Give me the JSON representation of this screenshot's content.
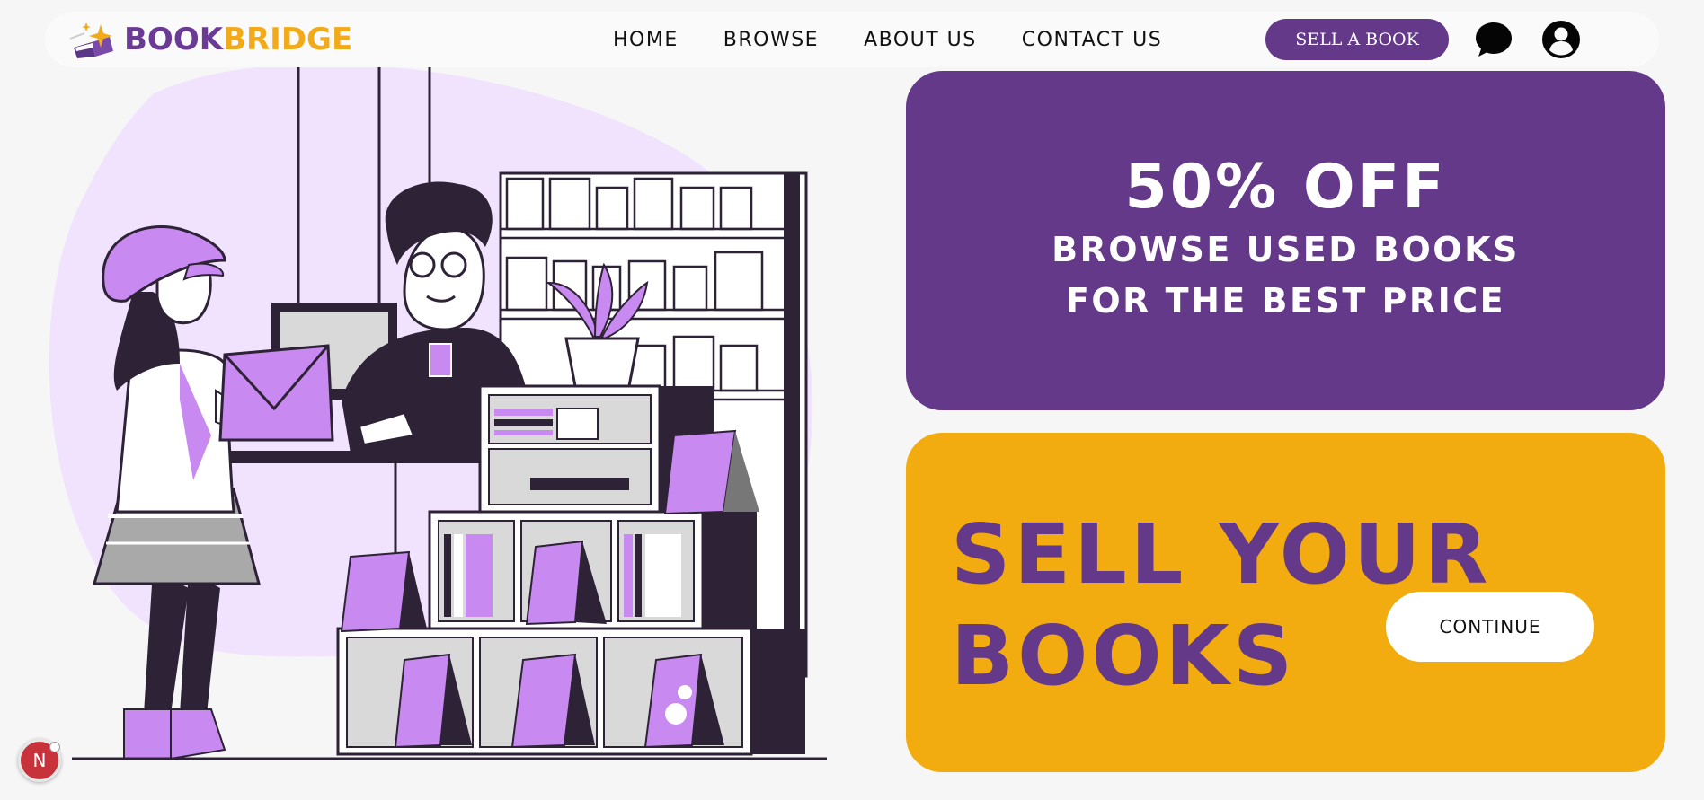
{
  "brand": {
    "name_part1": "BOOK",
    "name_part2": "BRIDGE",
    "logo_icon": "book-star-logo-icon",
    "colors": {
      "primary": "#653989",
      "accent": "#f2ac10",
      "background": "#f6f6f6"
    }
  },
  "nav": {
    "links": [
      "HOME",
      "BROWSE",
      "ABOUT US",
      "CONTACT US"
    ],
    "sell_button": "SELL A BOOK",
    "chat_icon": "chat-bubble-icon",
    "user_icon": "user-account-icon"
  },
  "hero": {
    "illustration": "bookstore-customer-illustration"
  },
  "promo": {
    "headline": "50% OFF",
    "line1": "BROWSE USED BOOKS",
    "line2": "FOR THE BEST PRICE"
  },
  "sell": {
    "line1": "SELL YOUR",
    "line2": "BOOKS",
    "button": "CONTINUE"
  },
  "dev_badge": {
    "letter": "N"
  }
}
